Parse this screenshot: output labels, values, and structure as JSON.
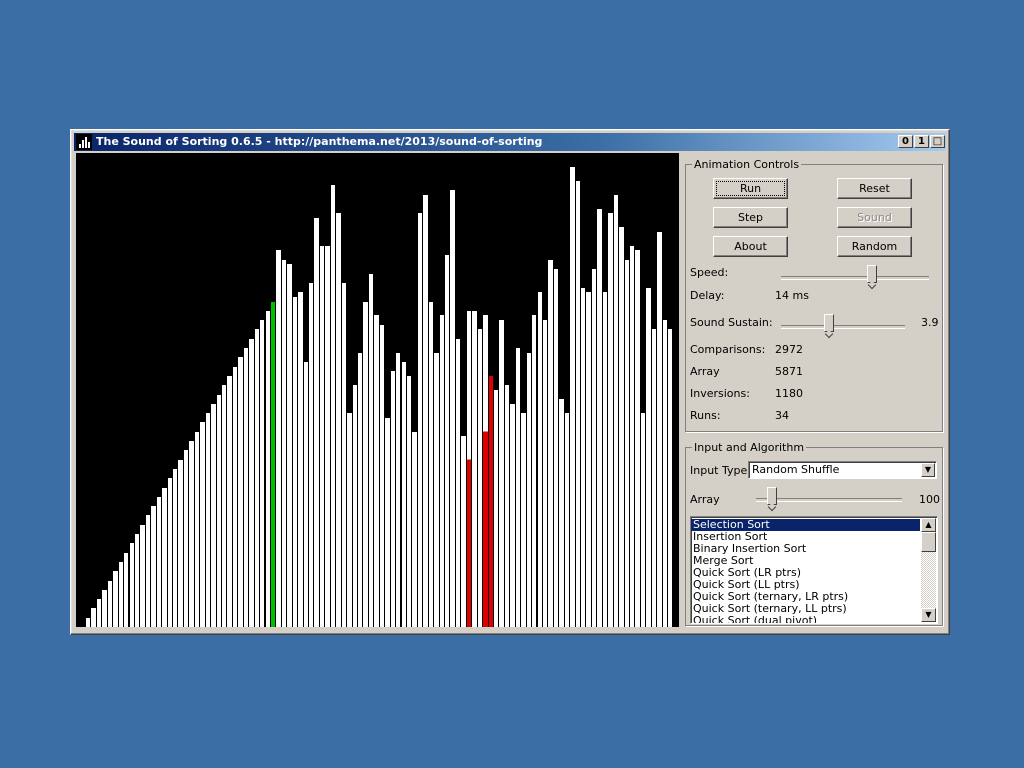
{
  "window": {
    "title": "The Sound of Sorting 0.6.5 - http://panthema.net/2013/sound-of-sorting",
    "buttons": [
      "minimize-icon",
      "restore-icon",
      "maximize-icon"
    ]
  },
  "visualization": {
    "colors": {
      "background": "#000000",
      "default": "#ffffff",
      "highlight_green": "#00c000",
      "highlight_red": "#e00000"
    },
    "values": [
      2,
      4,
      6,
      8,
      10,
      12,
      14,
      16,
      18,
      20,
      22,
      24,
      26,
      28,
      30,
      32,
      34,
      36,
      38,
      40,
      42,
      44,
      46,
      48,
      50,
      52,
      54,
      56,
      58,
      60,
      62,
      64,
      66,
      68,
      70,
      81,
      79,
      78,
      71,
      72,
      57,
      74,
      88,
      82,
      82,
      95,
      89,
      74,
      46,
      52,
      59,
      70,
      76,
      67,
      65,
      45,
      55,
      59,
      57,
      54,
      42,
      89,
      93,
      70,
      59,
      67,
      80,
      94,
      62,
      41,
      68,
      68,
      64,
      67,
      54,
      51,
      66,
      52,
      48,
      60,
      46,
      59,
      67,
      72,
      66,
      79,
      77,
      49,
      46,
      99,
      96,
      73,
      72,
      77,
      90,
      72,
      89,
      93,
      86,
      79,
      82,
      81,
      46,
      73,
      64,
      85,
      66,
      64
    ],
    "green_indices": [
      34
    ],
    "red_indices": [
      70,
      73,
      74
    ],
    "red_partial": {
      "70": 36,
      "73": 42
    }
  },
  "animation_controls": {
    "legend": "Animation Controls",
    "buttons": {
      "run": "Run",
      "reset": "Reset",
      "step": "Step",
      "sound": "Sound",
      "about": "About",
      "random": "Random"
    },
    "speed": {
      "label": "Speed:",
      "level": 0.62
    },
    "delay": {
      "label": "Delay:",
      "value": "14 ms"
    },
    "sound_sustain": {
      "label": "Sound Sustain:",
      "value": "3.9",
      "level": 0.38
    },
    "stats": [
      {
        "label": "Comparisons:",
        "value": "2972"
      },
      {
        "label": "Array",
        "value": "5871"
      },
      {
        "label": "Inversions:",
        "value": "1180"
      },
      {
        "label": "Runs:",
        "value": "34"
      }
    ]
  },
  "input_algorithm": {
    "legend": "Input and Algorithm",
    "input_type": {
      "label": "Input Type:",
      "value": "Random Shuffle"
    },
    "array": {
      "label": "Array",
      "value": "100",
      "level": 0.08
    },
    "algorithms": [
      "Selection Sort",
      "Insertion Sort",
      "Binary Insertion Sort",
      "Merge Sort",
      "Quick Sort (LR ptrs)",
      "Quick Sort (LL ptrs)",
      "Quick Sort (ternary, LR ptrs)",
      "Quick Sort (ternary, LL ptrs)",
      "Quick Sort (dual pivot)"
    ],
    "selected_index": 0
  }
}
